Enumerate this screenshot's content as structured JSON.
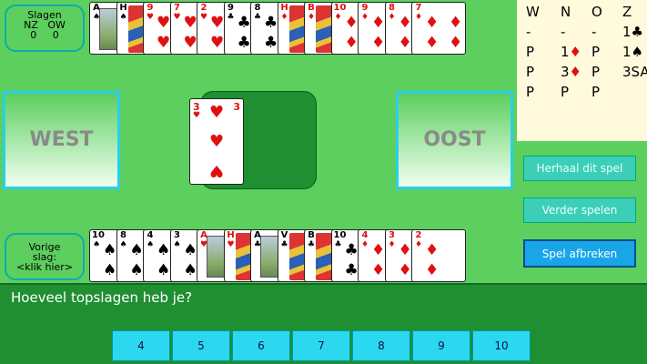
{
  "score": {
    "title": "Slagen",
    "nz_label": "NZ",
    "ow_label": "OW",
    "nz_value": "0",
    "ow_value": "0"
  },
  "prev_trick": {
    "line1": "Vorige",
    "line2": "slag:",
    "line3": "<klik hier>"
  },
  "west_label": "WEST",
  "east_label": "OOST",
  "north_hand": [
    {
      "rank": "A",
      "suit": "♠",
      "color": "black",
      "type": "ace"
    },
    {
      "rank": "H",
      "suit": "♠",
      "color": "black",
      "type": "face"
    },
    {
      "rank": "9",
      "suit": "♥",
      "color": "red",
      "type": "pip"
    },
    {
      "rank": "7",
      "suit": "♥",
      "color": "red",
      "type": "pip"
    },
    {
      "rank": "2",
      "suit": "♥",
      "color": "red",
      "type": "pip"
    },
    {
      "rank": "9",
      "suit": "♣",
      "color": "black",
      "type": "pip"
    },
    {
      "rank": "8",
      "suit": "♣",
      "color": "black",
      "type": "pip"
    },
    {
      "rank": "H",
      "suit": "♦",
      "color": "red",
      "type": "face"
    },
    {
      "rank": "B",
      "suit": "♦",
      "color": "red",
      "type": "face"
    },
    {
      "rank": "10",
      "suit": "♦",
      "color": "red",
      "type": "pip"
    },
    {
      "rank": "9",
      "suit": "♦",
      "color": "red",
      "type": "pip"
    },
    {
      "rank": "8",
      "suit": "♦",
      "color": "red",
      "type": "pip"
    },
    {
      "rank": "7",
      "suit": "♦",
      "color": "red",
      "type": "pip"
    }
  ],
  "south_hand": [
    {
      "rank": "10",
      "suit": "♠",
      "color": "black",
      "type": "pip"
    },
    {
      "rank": "8",
      "suit": "♠",
      "color": "black",
      "type": "pip"
    },
    {
      "rank": "4",
      "suit": "♠",
      "color": "black",
      "type": "pip"
    },
    {
      "rank": "3",
      "suit": "♠",
      "color": "black",
      "type": "pip"
    },
    {
      "rank": "A",
      "suit": "♥",
      "color": "red",
      "type": "ace"
    },
    {
      "rank": "H",
      "suit": "♥",
      "color": "red",
      "type": "face"
    },
    {
      "rank": "A",
      "suit": "♣",
      "color": "black",
      "type": "ace"
    },
    {
      "rank": "V",
      "suit": "♣",
      "color": "black",
      "type": "face"
    },
    {
      "rank": "B",
      "suit": "♣",
      "color": "black",
      "type": "face"
    },
    {
      "rank": "10",
      "suit": "♣",
      "color": "black",
      "type": "pip"
    },
    {
      "rank": "4",
      "suit": "♦",
      "color": "red",
      "type": "pip"
    },
    {
      "rank": "3",
      "suit": "♦",
      "color": "red",
      "type": "pip"
    },
    {
      "rank": "2",
      "suit": "♦",
      "color": "red",
      "type": "pip"
    }
  ],
  "played_card": {
    "rank": "3",
    "suit": "♥",
    "color": "red"
  },
  "bidding": {
    "headers": [
      "W",
      "N",
      "O",
      "Z"
    ],
    "rows": [
      [
        "-",
        "-",
        "-",
        "1♣"
      ],
      [
        "P",
        "1♦",
        "P",
        "1♠"
      ],
      [
        "P",
        "3♦",
        "P",
        "3SA"
      ],
      [
        "P",
        "P",
        "P",
        ""
      ]
    ]
  },
  "buttons": {
    "replay": "Herhaal dit spel",
    "continue": "Verder spelen",
    "abort": "Spel afbreken"
  },
  "question": "Hoeveel topslagen heb je?",
  "answers": [
    "4",
    "5",
    "6",
    "7",
    "8",
    "9",
    "10"
  ],
  "colors": {
    "felt": "#5ccf5f",
    "dark_felt": "#1f8f32",
    "cyan": "#2ad0ea",
    "panel": "#fffadc",
    "red_suit": "#e01010"
  }
}
